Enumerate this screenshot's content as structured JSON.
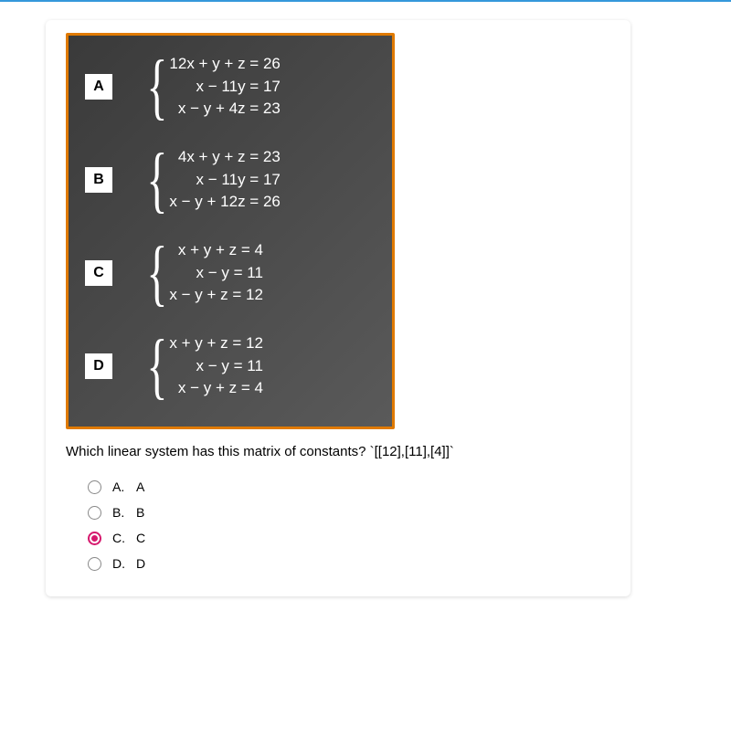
{
  "board": {
    "options": [
      {
        "badge": "A",
        "equations": [
          "12x + y + z = 26",
          "x − 11y = 17",
          "x − y + 4z = 23"
        ]
      },
      {
        "badge": "B",
        "equations": [
          "4x + y + z = 23",
          "x − 11y = 17",
          "x − y + 12z = 26"
        ]
      },
      {
        "badge": "C",
        "equations": [
          "x + y + z = 4",
          "x − y = 11",
          "x − y + z = 12"
        ]
      },
      {
        "badge": "D",
        "equations": [
          "x + y + z = 12",
          "x − y = 11",
          "x − y + z = 4"
        ]
      }
    ]
  },
  "question_text": "Which linear system has this matrix of constants? `[[12],[11],[4]]`",
  "answers": [
    {
      "letter": "A.",
      "label": "A",
      "selected": false
    },
    {
      "letter": "B.",
      "label": "B",
      "selected": false
    },
    {
      "letter": "C.",
      "label": "C",
      "selected": true
    },
    {
      "letter": "D.",
      "label": "D",
      "selected": false
    }
  ]
}
